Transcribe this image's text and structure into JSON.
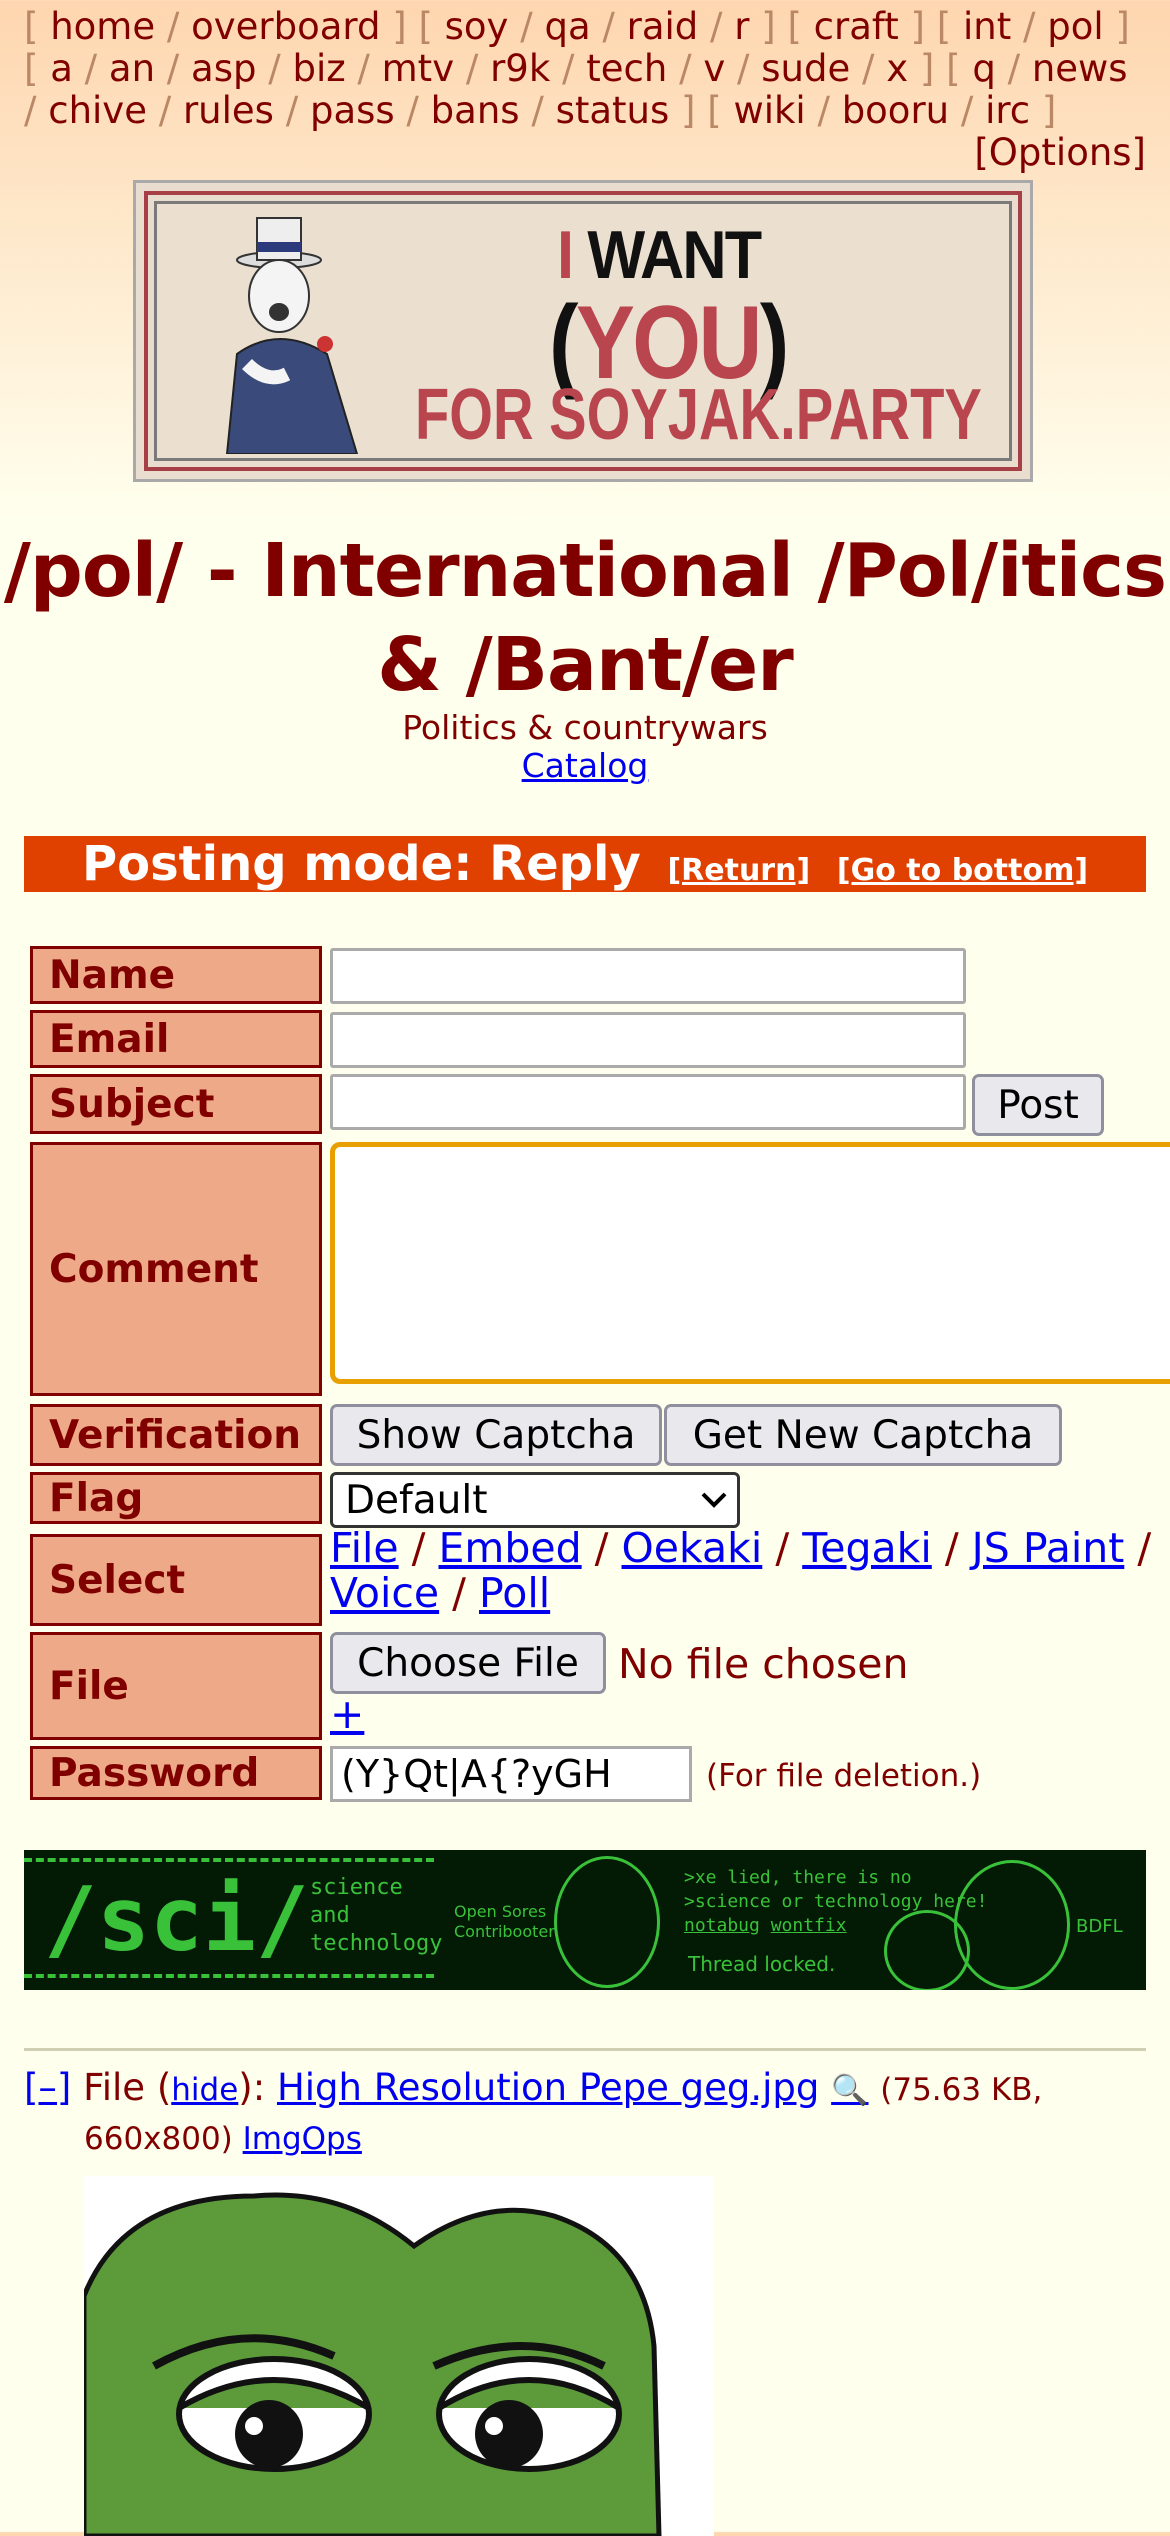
{
  "boardlist": {
    "groups": [
      [
        "home",
        "overboard"
      ],
      [
        "soy",
        "qa",
        "raid",
        "r"
      ],
      [
        "craft"
      ],
      [
        "int",
        "pol"
      ],
      [
        "a",
        "an",
        "asp",
        "biz",
        "mtv",
        "r9k",
        "tech",
        "v",
        "sude",
        "x"
      ],
      [
        "q",
        "news",
        "chive",
        "rules",
        "pass",
        "bans",
        "status"
      ],
      [
        "wiki",
        "booru",
        "irc"
      ]
    ],
    "options_label": "[Options]"
  },
  "banner": {
    "line1_pre": "I ",
    "line1_main": "WANT",
    "line2_open": "(",
    "line2_main": "YOU",
    "line2_close": ")",
    "line3": "FOR SOYJAK.PARTY"
  },
  "board": {
    "title": "/pol/ - International /Pol/itics & /Bant/er",
    "subtitle": "Politics & countrywars",
    "catalog_link": "Catalog"
  },
  "posting_mode": {
    "label": "Posting mode: Reply",
    "return_link": "[Return]",
    "bottom_link": "[Go to bottom]"
  },
  "form": {
    "name_label": "Name",
    "email_label": "Email",
    "subject_label": "Subject",
    "post_button": "Post",
    "comment_label": "Comment",
    "verification_label": "Verification",
    "show_captcha_button": "Show Captcha",
    "new_captcha_button": "Get New Captcha",
    "flag_label": "Flag",
    "flag_selected": "Default",
    "select_label": "Select",
    "select_links": [
      "File",
      "Embed",
      "Oekaki",
      "Tegaki",
      "JS Paint",
      "Voice",
      "Poll"
    ],
    "file_label": "File",
    "choose_file_button": "Choose File",
    "no_file_text": "No file chosen",
    "add_file_link": "+",
    "password_label": "Password",
    "password_value": "(Y}Qt|A{?yGH",
    "password_note": "(For file deletion.)"
  },
  "sci_banner": {
    "big": "/sci/",
    "small": [
      "science",
      "and",
      "technology"
    ],
    "mid": [
      "Open Sores",
      "Contribooter"
    ],
    "quote": [
      ">xe lied, there is no",
      ">science or technology here!"
    ],
    "links": [
      "notabug",
      "wontfix"
    ],
    "locked": "Thread locked.",
    "bdfl": "BDFL"
  },
  "post": {
    "collapse": "[–]",
    "file_prefix": "File (",
    "hide_link": "hide",
    "file_mid": "): ",
    "filename": "High Resolution Pepe geg.jpg",
    "file_icon": "🔍",
    "meta_1": "(75.63 KB,",
    "meta_2": "660x800)",
    "imgops": "ImgOps"
  },
  "colors": {
    "accent": "#800000",
    "posting_mode_bg": "#e04000",
    "label_bg": "#eeaa88",
    "page_bg": "#ffffee",
    "link": "#0000ee"
  }
}
